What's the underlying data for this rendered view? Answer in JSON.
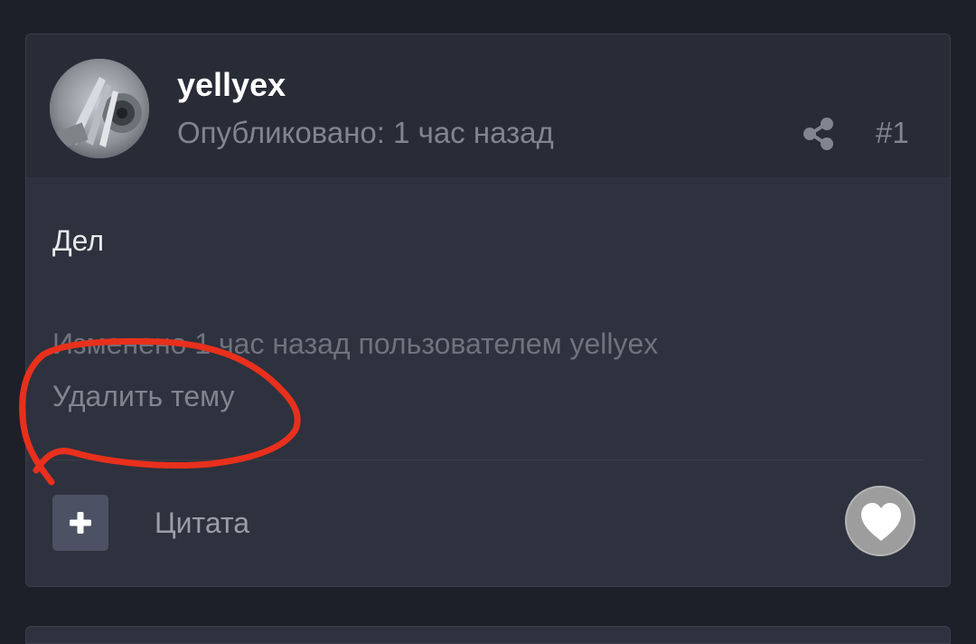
{
  "post": {
    "author": "yellyex",
    "published": "Опубликовано: 1 час назад",
    "number": "#1",
    "body": "Дел",
    "edited_note": "Изменено 1 час назад пользователем yellyex",
    "delete_topic": "Удалить тему"
  },
  "actions": {
    "quote_label": "Цитата",
    "quote_plus_icon": "plus-icon",
    "share_icon": "share-icon",
    "like_icon": "heart-icon"
  },
  "colors": {
    "page_background": "#1d2029",
    "card_background": "#2e323e",
    "header_background": "#282c36",
    "annotation_stroke": "#e8301c"
  }
}
